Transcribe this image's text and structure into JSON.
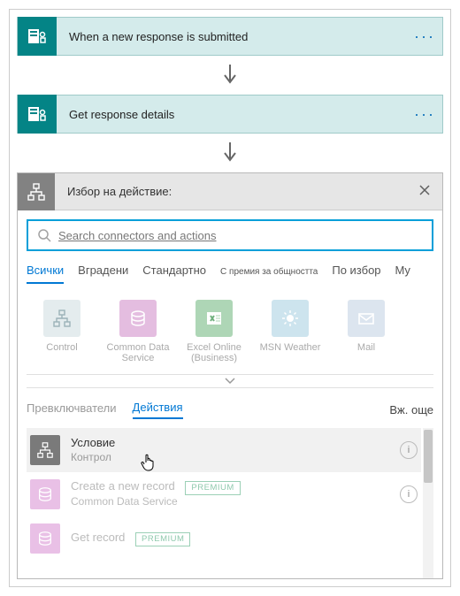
{
  "cards": {
    "trigger": {
      "title": "When a new response is submitted"
    },
    "action1": {
      "title": "Get response details"
    }
  },
  "panel": {
    "title": "Избор на действие:"
  },
  "search": {
    "placeholder": "Search connectors and actions"
  },
  "tabs": {
    "all": "Всички",
    "builtin": "Вградени",
    "standard": "Стандартно",
    "premium": "С премия за общността",
    "custom": "По избор",
    "my": "My"
  },
  "connectors": [
    {
      "label": "Control",
      "color": "#b5c7cc"
    },
    {
      "label": "Common Data Service",
      "color": "#e4bde0"
    },
    {
      "label": "Excel Online (Business)",
      "color": "#aed6b6"
    },
    {
      "label": "MSN Weather",
      "color": "#b8d6e2"
    },
    {
      "label": "Mail",
      "color": "#c7d3e0"
    }
  ],
  "subtabs": {
    "triggers": "Превключватели",
    "actions": "Действия",
    "seeMore": "Вж. още"
  },
  "actions": [
    {
      "name": "Условие",
      "sub": "Контрол",
      "icon": "control",
      "color": "#7a7a7a",
      "highlight": true
    },
    {
      "name": "Create a new record",
      "sub": "Common Data Service",
      "icon": "cds",
      "color": "#e9c0e6",
      "premium": "PREMIUM",
      "faded": true
    },
    {
      "name": "Get record",
      "sub": "",
      "icon": "cds",
      "color": "#e9c0e6",
      "premium": "PREMIUM",
      "faded": true
    }
  ]
}
